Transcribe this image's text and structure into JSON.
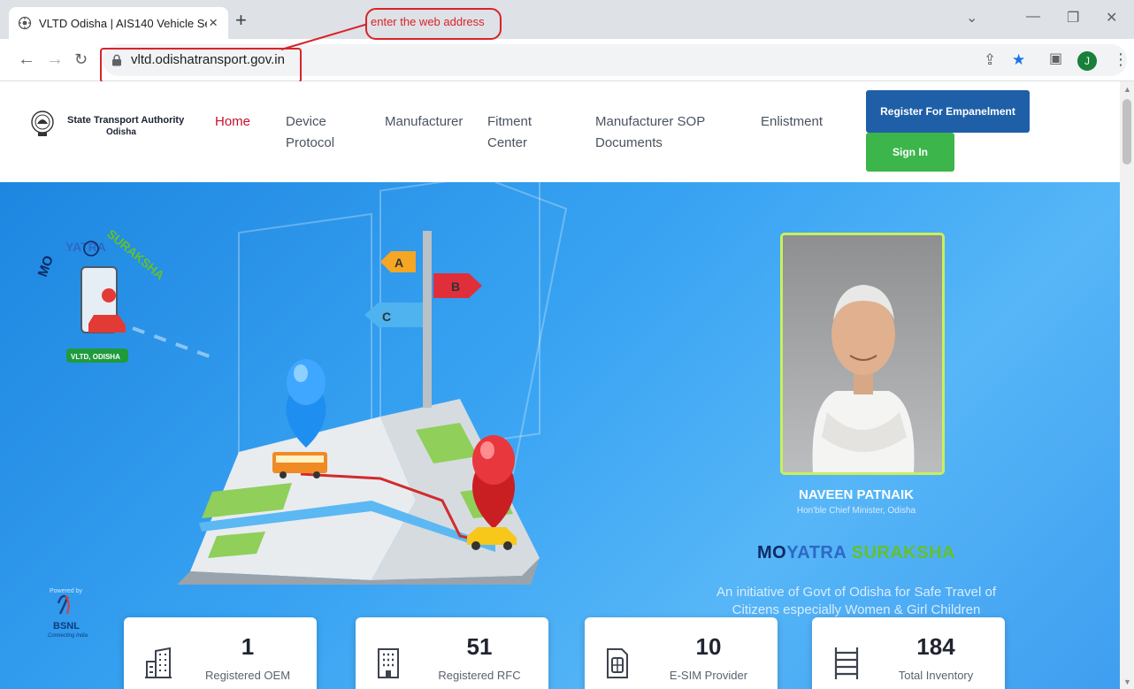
{
  "browser": {
    "tab_title": "VLTD Odisha | AIS140 Vehicle Sec",
    "url": "vltd.odishatransport.gov.in",
    "profile_initial": "J",
    "annotation_text": "enter the web address"
  },
  "header": {
    "brand_name": "State Transport Authority",
    "brand_sub": "Odisha",
    "nav": [
      {
        "label": "Home",
        "active": true
      },
      {
        "label": "Device",
        "label2": "Protocol"
      },
      {
        "label": "Manufacturer"
      },
      {
        "label": "Fitment",
        "label2": "Center"
      },
      {
        "label": "Manufacturer SOP",
        "label2": "Documents"
      },
      {
        "label": "Enlistment"
      }
    ],
    "register_button": "Register For Empanelment",
    "signin_button": "Sign In"
  },
  "hero": {
    "logo_text": "MOYATRASURAKSHA",
    "logo_badge": "VLTD, ODISHA",
    "signposts": [
      "A",
      "B",
      "C"
    ],
    "person_name": "NAVEEN PATNAIK",
    "person_title": "Hon'ble Chief Minister, Odisha",
    "tagline": {
      "p1": "MO",
      "p2": "YATRA",
      "p3": "SURAKSHA"
    },
    "initiative_line1": "An initiative of Govt of Odisha for Safe Travel of",
    "initiative_line2": "Citizens especially Women & Girl Children",
    "powered_by": "Powered by",
    "bsnl": "BSNL",
    "bsnl_tag": "Connecting India"
  },
  "stats": [
    {
      "value": "1",
      "label": "Registered OEM",
      "icon": "building-icon"
    },
    {
      "value": "51",
      "label": "Registered RFC",
      "icon": "office-icon"
    },
    {
      "value": "10",
      "label": "E-SIM Provider",
      "icon": "sim-icon"
    },
    {
      "value": "184",
      "label": "Total Inventory",
      "icon": "ladder-icon"
    }
  ],
  "colors": {
    "nav_active": "#c8102e",
    "register_bg": "#1f5fa8",
    "signin_bg": "#3cb54a",
    "annotation": "#d8232a",
    "hero_blue": "#2d95ea"
  }
}
